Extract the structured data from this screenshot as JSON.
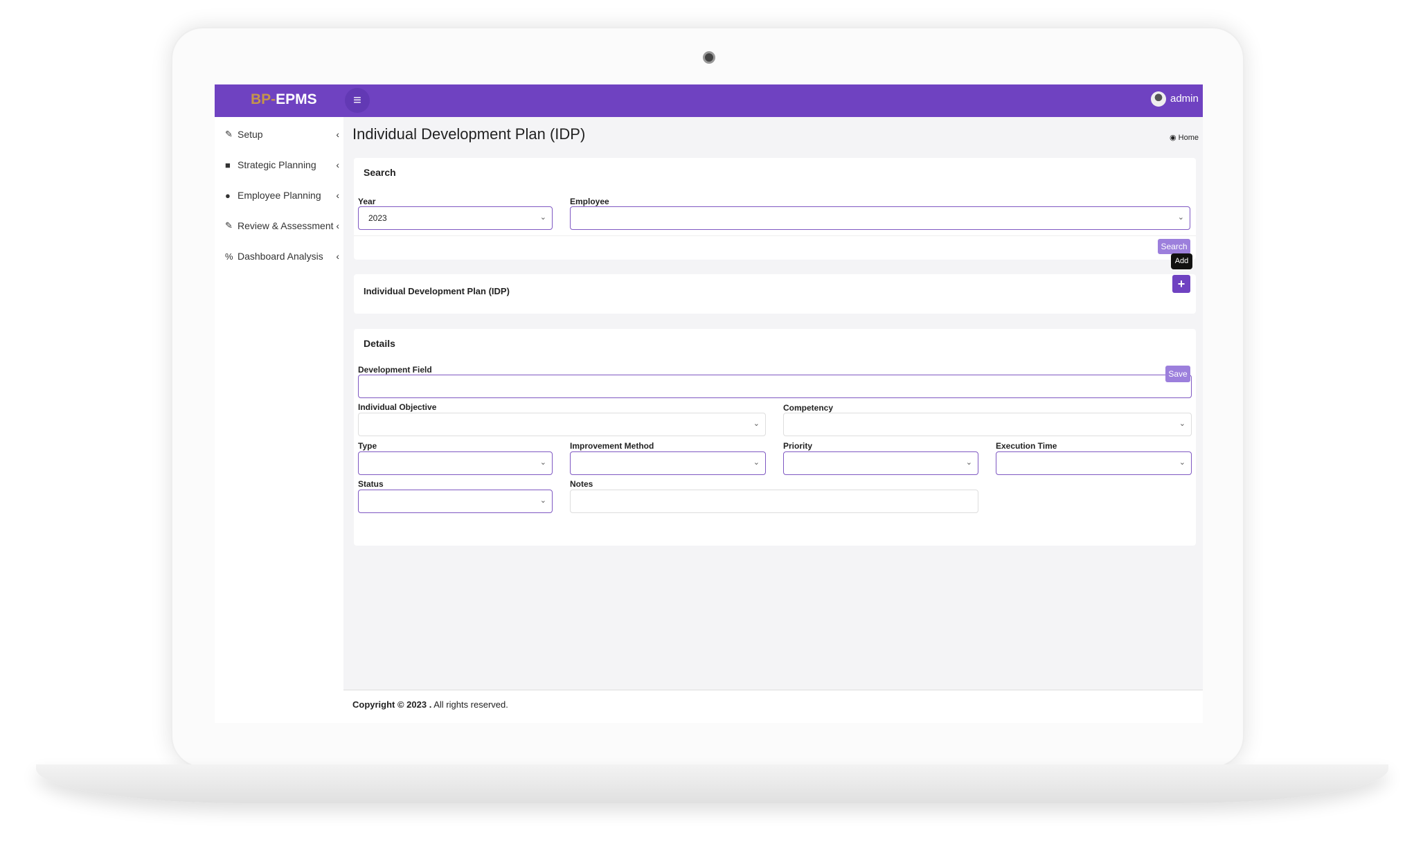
{
  "app": {
    "logo_prefix": "BP-",
    "logo_suffix": "EPMS",
    "user": "admin"
  },
  "sidebar": {
    "items": [
      {
        "label": "Setup",
        "icon": "edit-icon"
      },
      {
        "label": "Strategic Planning",
        "icon": "briefcase-icon"
      },
      {
        "label": "Employee Planning",
        "icon": "user-icon"
      },
      {
        "label": "Review & Assessment",
        "icon": "edit-icon"
      },
      {
        "label": "Dashboard Analysis",
        "icon": "percent-icon"
      }
    ]
  },
  "page": {
    "title": "Individual Development Plan (IDP)",
    "breadcrumb": "Home"
  },
  "search": {
    "title": "Search",
    "year_label": "Year",
    "year_value": "2023",
    "employee_label": "Employee",
    "employee_value": "",
    "button": "Search"
  },
  "idp": {
    "title": "Individual Development Plan (IDP)",
    "add_tooltip": "Add",
    "add_icon": "+"
  },
  "details": {
    "title": "Details",
    "development_field": "Development Field",
    "individual_objective": "Individual Objective",
    "competency": "Competency",
    "type": "Type",
    "improvement_method": "Improvement Method",
    "priority": "Priority",
    "execution_time": "Execution Time",
    "status": "Status",
    "notes": "Notes",
    "save": "Save"
  },
  "footer": {
    "copyright": "Copyright © 2023 .",
    "rights": " All rights reserved."
  },
  "colors": {
    "accent": "#6f42c1",
    "button": "#9c7fdc",
    "logo_prefix": "#c5954a"
  }
}
